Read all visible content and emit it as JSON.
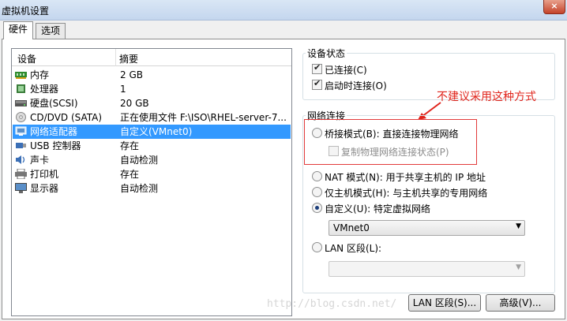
{
  "window": {
    "title": "虚拟机设置",
    "close_glyph": "×"
  },
  "tabs": [
    {
      "label": "硬件"
    },
    {
      "label": "选项"
    }
  ],
  "device_list": {
    "headers": {
      "device": "设备",
      "summary": "摘要"
    },
    "rows": [
      {
        "icon": "memory-icon",
        "name": "内存",
        "summary": "2 GB"
      },
      {
        "icon": "processor-icon",
        "name": "处理器",
        "summary": "1"
      },
      {
        "icon": "hard-disk-icon",
        "name": "硬盘(SCSI)",
        "summary": "20 GB"
      },
      {
        "icon": "cd-dvd-icon",
        "name": "CD/DVD (SATA)",
        "summary": "正在使用文件 F:\\ISO\\RHEL-server-7..."
      },
      {
        "icon": "network-adapter-icon",
        "name": "网络适配器",
        "summary": "自定义(VMnet0)",
        "selected": true
      },
      {
        "icon": "usb-icon",
        "name": "USB 控制器",
        "summary": "存在"
      },
      {
        "icon": "sound-card-icon",
        "name": "声卡",
        "summary": "自动检测"
      },
      {
        "icon": "printer-icon",
        "name": "打印机",
        "summary": "存在"
      },
      {
        "icon": "display-icon",
        "name": "显示器",
        "summary": "自动检测"
      }
    ]
  },
  "device_status": {
    "title": "设备状态",
    "connected": {
      "label": "已连接(C)",
      "checked": true
    },
    "connect_at_power_on": {
      "label": "启动时连接(O)",
      "checked": true
    }
  },
  "network_connection": {
    "title": "网络连接",
    "bridged": {
      "label": "桥接模式(B): 直接连接物理网络",
      "selected": false
    },
    "replicate": {
      "label": "复制物理网络连接状态(P)",
      "checked": false,
      "disabled": true
    },
    "nat": {
      "label": "NAT 模式(N): 用于共享主机的 IP 地址",
      "selected": false
    },
    "host_only": {
      "label": "仅主机模式(H): 与主机共享的专用网络",
      "selected": false
    },
    "custom": {
      "label": "自定义(U): 特定虚拟网络",
      "selected": true
    },
    "custom_network": {
      "value": "VMnet0"
    },
    "lan_segment": {
      "label": "LAN 区段(L):",
      "selected": false
    },
    "lan_segment_select": {
      "value": ""
    }
  },
  "buttons": {
    "lan_segments": "LAN 区段(S)...",
    "advanced": "高级(V)..."
  },
  "annotation": {
    "text": "不建议采用这种方式",
    "color": "#e0241b"
  },
  "watermark": {
    "text": "http://blog.csdn.net/"
  },
  "colors": {
    "selection": "#3399ff",
    "titlebar": "#c4d6ee"
  }
}
